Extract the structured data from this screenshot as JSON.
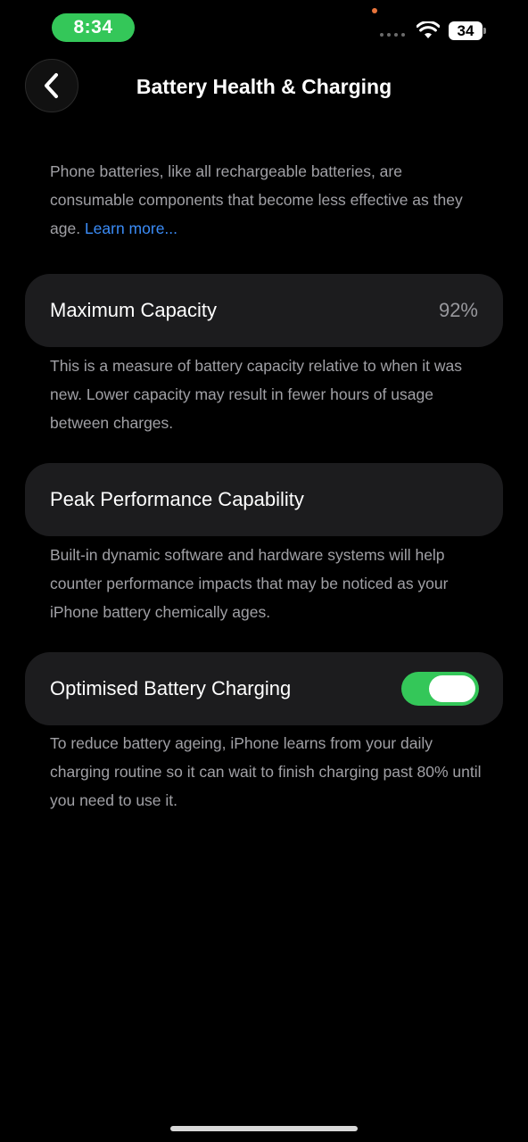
{
  "status_bar": {
    "time": "8:34",
    "battery_level": "34",
    "icons": [
      "orange-dot-indicator",
      "signal-dots-icon",
      "wifi-icon",
      "battery-icon"
    ]
  },
  "header": {
    "back_icon": "chevron-left-icon",
    "title": "Battery Health & Charging"
  },
  "intro": {
    "text": "Phone batteries, like all rechargeable batteries, are consumable components that become less effective as they age. ",
    "link": "Learn more..."
  },
  "max_capacity": {
    "label": "Maximum Capacity",
    "value": "92%",
    "description": "This is a measure of battery capacity relative to when it was new. Lower capacity may result in fewer hours of usage between charges."
  },
  "peak_performance": {
    "label": "Peak Performance Capability",
    "description": "Built-in dynamic software and hardware systems will help counter performance impacts that may be noticed as your iPhone battery chemically ages."
  },
  "optimised_charging": {
    "label": "Optimised Battery Charging",
    "enabled": true,
    "description": "To reduce battery ageing, iPhone learns from your daily charging routine so it can wait to finish charging past 80% until you need to use it."
  },
  "colors": {
    "accent_green": "#34c759",
    "link_blue": "#3b8cf7",
    "card_bg": "#1c1c1e",
    "secondary_text": "#a0a0a5",
    "status_dot_orange": "#e8743b"
  }
}
